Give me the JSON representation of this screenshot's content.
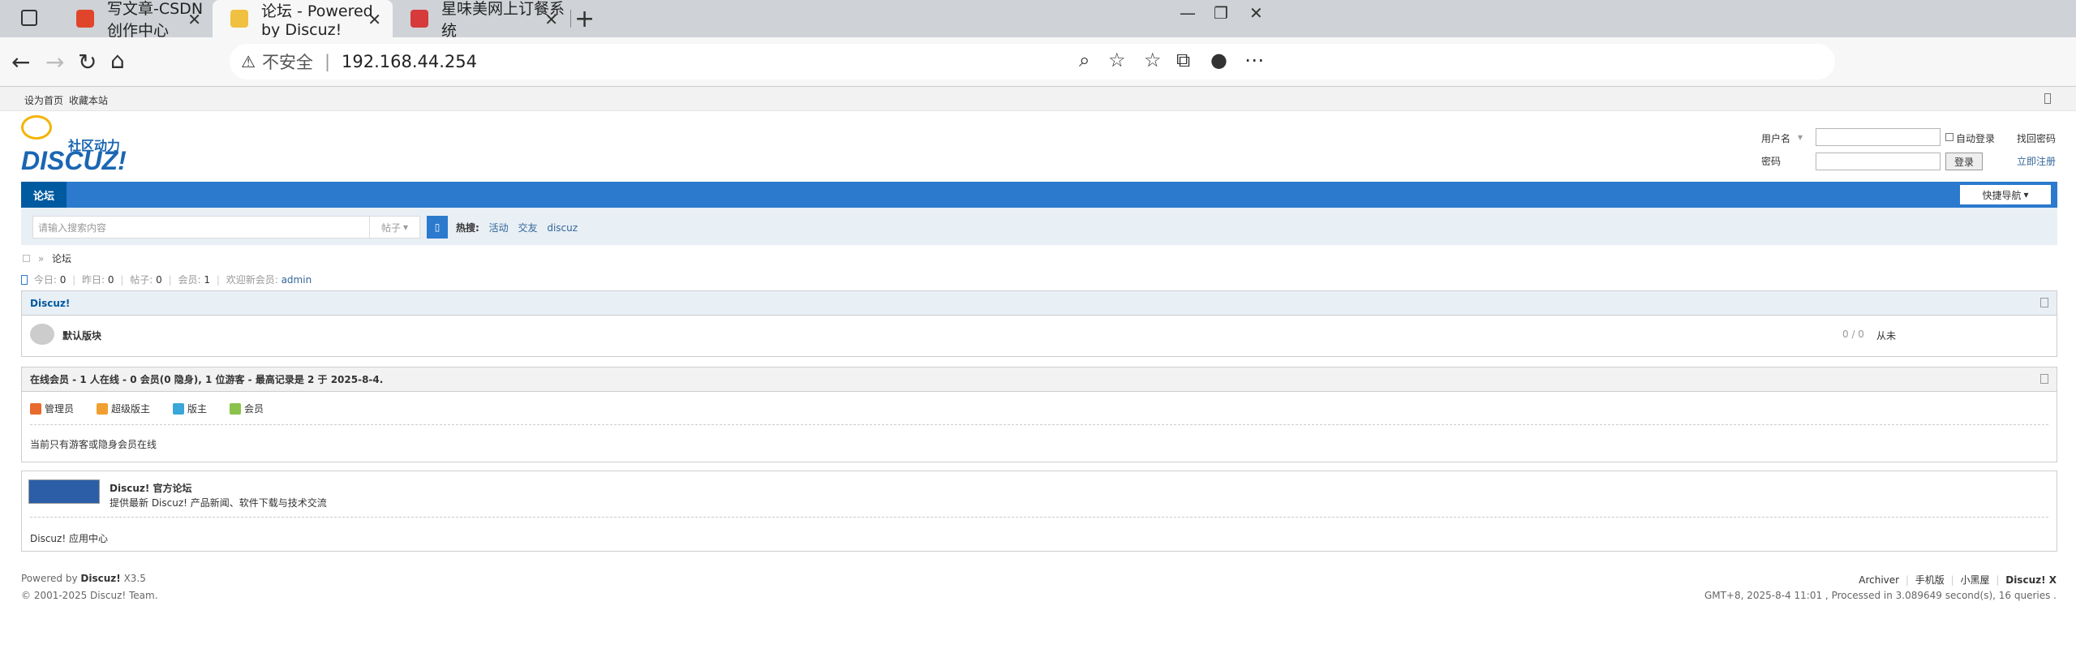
{
  "browser": {
    "tabs": [
      {
        "title": "写文章-CSDN创作中心",
        "favicon_color": "#e0452b"
      },
      {
        "title": "论坛 - Powered by Discuz!",
        "favicon_color": "#f0c040"
      },
      {
        "title": "星味美网上订餐系统",
        "favicon_color": "#d63a3a"
      }
    ],
    "address": {
      "security": "不安全",
      "url": "192.168.44.254"
    }
  },
  "page": {
    "topbar": {
      "set_home": "设为首页",
      "bookmark": "收藏本站"
    },
    "logo": {
      "slogan": "社区动力",
      "name": "DISCUZ!"
    },
    "login": {
      "username_label": "用户名",
      "password_label": "密码",
      "auto_login": "自动登录",
      "find_password": "找回密码",
      "login_button": "登录",
      "register": "立即注册"
    },
    "nav": {
      "forum_tab": "论坛",
      "quick_nav": "快捷导航"
    },
    "search": {
      "placeholder": "请输入搜索内容",
      "type": "帖子",
      "hot_label": "热搜:",
      "hot": [
        "活动",
        "交友",
        "discuz"
      ]
    },
    "breadcrumb": {
      "current": "论坛"
    },
    "stats": {
      "today_label": "今日:",
      "today": "0",
      "yesterday_label": "昨日:",
      "yesterday": "0",
      "posts_label": "帖子:",
      "posts": "0",
      "members_label": "会员:",
      "members": "1",
      "newest_label": "欢迎新会员:",
      "newest": "admin"
    },
    "category": {
      "title": "Discuz!",
      "forum": {
        "name": "默认版块",
        "counts": "0 / 0",
        "last": "从未"
      }
    },
    "online": {
      "title": "在线会员 - 1 人在线 - 0 会员(0 隐身), 1 位游客 - 最高记录是 2 于 2025-8-4.",
      "legend": [
        {
          "label": "管理员",
          "color": "#e86a2d"
        },
        {
          "label": "超级版主",
          "color": "#f0a030"
        },
        {
          "label": "版主",
          "color": "#3ba6d8"
        },
        {
          "label": "会员",
          "color": "#8bc34a"
        }
      ],
      "note": "当前只有游客或隐身会员在线"
    },
    "links": {
      "official_name": "Discuz! 官方论坛",
      "official_desc": "提供最新 Discuz! 产品新闻、软件下载与技术交流",
      "app_center": "Discuz! 应用中心"
    },
    "footer": {
      "powered_prefix": "Powered by",
      "powered_name": "Discuz!",
      "version": "X3.5",
      "copyright": "© 2001-2025 Discuz! Team.",
      "links": [
        "Archiver",
        "手机版",
        "小黑屋"
      ],
      "brand": "Discuz! X",
      "process": "GMT+8, 2025-8-4 11:01 , Processed in 3.089649 second(s), 16 queries ."
    }
  }
}
